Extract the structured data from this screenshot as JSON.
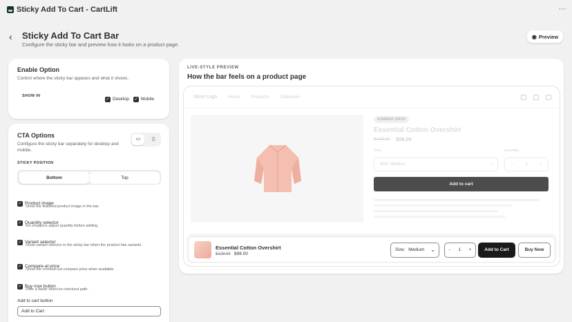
{
  "app": {
    "title": "Sticky Add To Cart - CartLift"
  },
  "header": {
    "title": "Sticky Add To Cart Bar",
    "subtitle": "Configure the sticky bar and preview how it looks on a product page.",
    "preview_label": "Preview"
  },
  "enable_option": {
    "title": "Enable Option",
    "subtitle": "Control where the sticky bar appears and what it shows.",
    "show_in_label": "SHOW IN",
    "desktop_label": "Desktop",
    "desktop_checked": true,
    "mobile_label": "Mobile",
    "mobile_checked": true
  },
  "cta": {
    "title": "CTA Options",
    "subtitle": "Configure the sticky bar separately for desktop and mobile.",
    "position_label": "STICKY POSITION",
    "positions": [
      "Bottom",
      "Top"
    ],
    "selected_position": "Bottom",
    "options": [
      {
        "label": "Product image",
        "desc": "Show the featured product image in the bar.",
        "checked": true
      },
      {
        "label": "Quantity selector",
        "desc": "Let shoppers adjust quantity before adding.",
        "checked": true
      },
      {
        "label": "Variant selector",
        "desc": "Show variant selector in the sticky bar when the product has variants.",
        "checked": true
      },
      {
        "label": "Compare-at price",
        "desc": "Show the crossed-out compare price when available.",
        "checked": true
      },
      {
        "label": "Buy now button",
        "desc": "Offer a faster direct-to-checkout path.",
        "checked": true
      }
    ],
    "add_to_cart_field_label": "Add to cart button",
    "add_to_cart_field_value": "Add to Cart"
  },
  "preview": {
    "eyebrow": "LIVE-STYLE PREVIEW",
    "title": "How the bar feels on a product page",
    "store": {
      "logo": "Store Logo",
      "nav": [
        "Home",
        "Products",
        "Collection"
      ]
    },
    "product": {
      "badge": "SUMMER DROP",
      "name": "Essential Cotton Overshirt",
      "compare_price": "$128.00",
      "price": "$98.00",
      "size_label": "Size",
      "quantity_label": "Quantity",
      "size_select": "Size:  Medium",
      "quantity": "1",
      "add_to_cart": "Add to cart"
    },
    "sticky_bar": {
      "name": "Essential Cotton Overshirt",
      "compare_price": "$128.00",
      "price": "$98.00",
      "size_label": "Size:",
      "size_value": "Medium",
      "qty_minus": "-",
      "qty_value": "1",
      "qty_plus": "+",
      "add_label": "Add to Cart",
      "buy_label": "Buy Now"
    }
  }
}
